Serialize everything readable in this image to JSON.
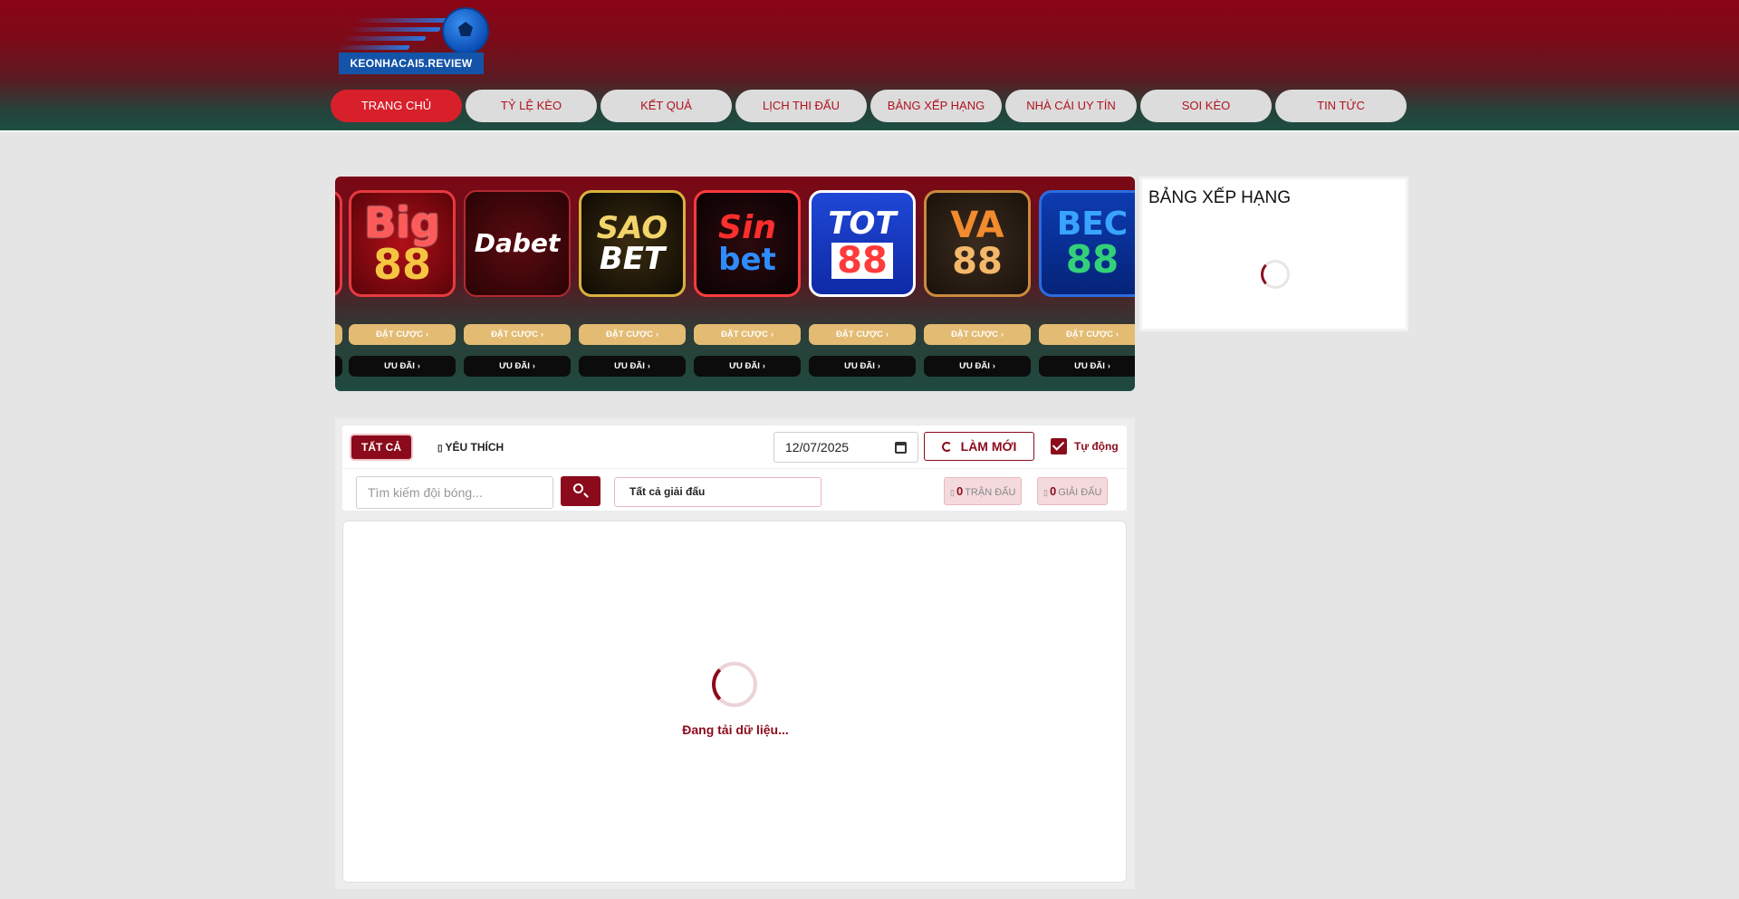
{
  "site": {
    "logo_text": "KEONHACAI5.REVIEW"
  },
  "nav": {
    "items": [
      {
        "label": "TRANG CHỦ",
        "active": true
      },
      {
        "label": "TỶ LỆ KÈO"
      },
      {
        "label": "KẾT QUẢ"
      },
      {
        "label": "LỊCH THI ĐẤU"
      },
      {
        "label": "BẢNG XẾP HẠNG"
      },
      {
        "label": "NHÀ CÁI UY TÍN"
      },
      {
        "label": "SOI KÈO"
      },
      {
        "label": "TIN TỨC"
      }
    ]
  },
  "banner": {
    "bet_label": "ĐẶT CƯỢC",
    "deal_label": "ƯU ĐÃI",
    "brands": [
      {
        "name": "Big 88",
        "line1": "Big",
        "line2": "88"
      },
      {
        "name": "Dabet",
        "line1": "Dabet"
      },
      {
        "name": "Sao Bet",
        "line1": "SAO",
        "line2": "BET"
      },
      {
        "name": "Sin bet",
        "line1": "Sin",
        "line2": "bet"
      },
      {
        "name": "TOT 88",
        "line1": "TOT",
        "line2": "88"
      },
      {
        "name": "VA 88",
        "line1": "VA",
        "line2": "88"
      },
      {
        "name": "BEC 88",
        "line1": "BEC",
        "line2": "88"
      }
    ]
  },
  "standings": {
    "title": "BẢNG XẾP HẠNG"
  },
  "filters": {
    "tab_all": "TẤT CẢ",
    "tab_fav": "YÊU THÍCH",
    "date_value": "12/07/2025",
    "refresh_label": "LÀM MỚI",
    "auto_label": "Tự động",
    "auto_checked": true,
    "search_placeholder": "Tìm kiếm đội bóng...",
    "league_selected": "Tất cả giải đấu",
    "matches_count": "0",
    "matches_label": "TRẬN ĐẤU",
    "leagues_count": "0",
    "leagues_label": "GIẢI ĐẤU"
  },
  "content": {
    "loading_text": "Đang tải dữ liệu..."
  },
  "colors": {
    "primary": "#8b0b1c",
    "nav_active": "#d8202b",
    "nav_text": "#b0121f",
    "bet_button": "#e3bb72",
    "deal_button": "#0c0c0c",
    "page_bg": "#e5e5e5"
  }
}
